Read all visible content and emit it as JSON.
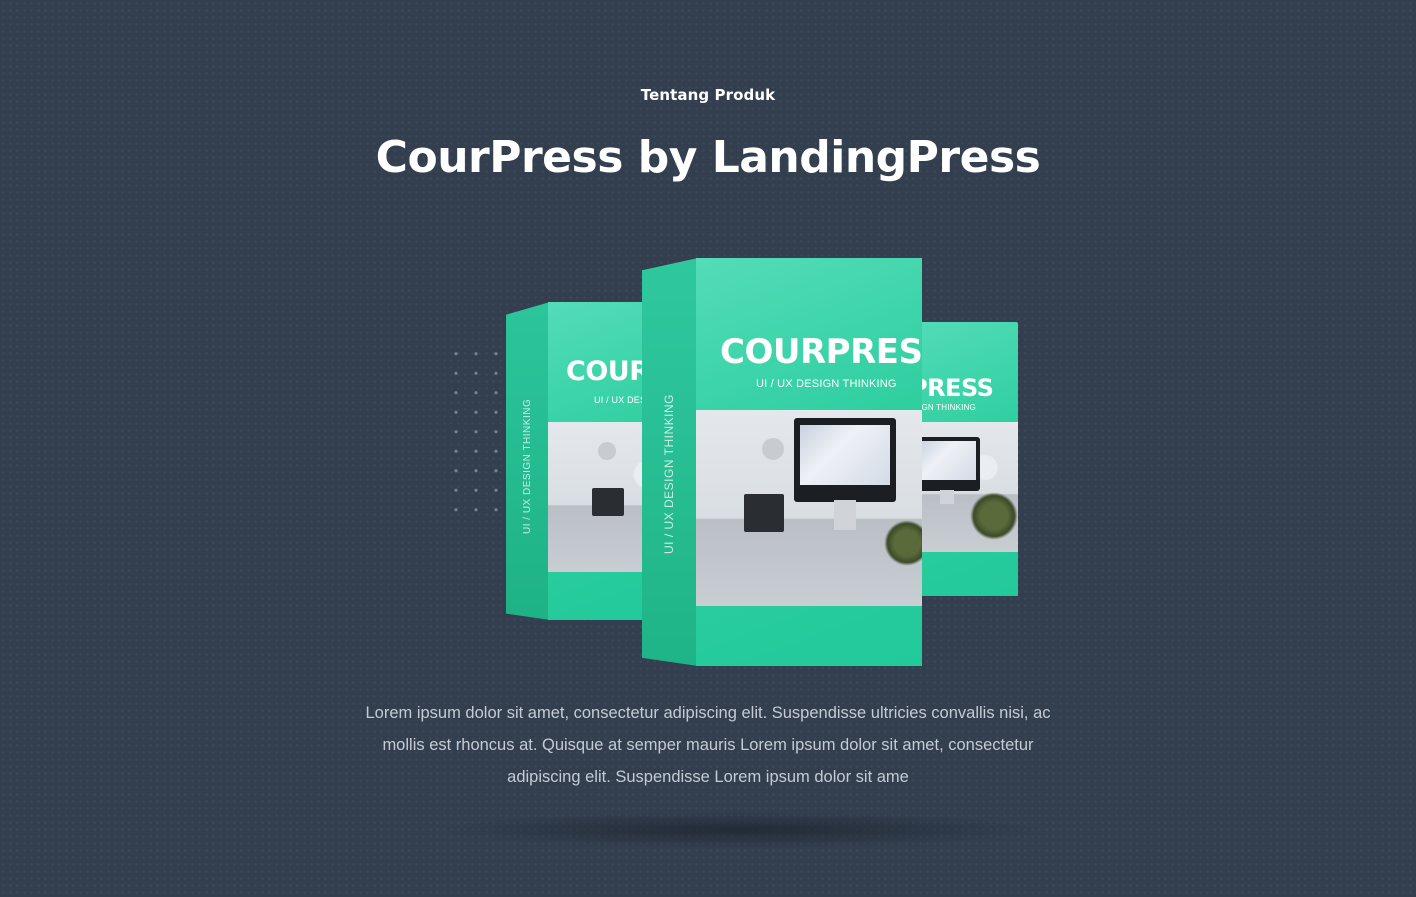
{
  "section": {
    "eyebrow": "Tentang Produk",
    "title": "CourPress by LandingPress",
    "description": "Lorem ipsum dolor sit amet, consectetur adipiscing elit. Suspendisse ultricies convallis nisi, ac mollis est rhoncus at. Quisque at semper mauris Lorem ipsum dolor sit amet, consectetur adipiscing elit. Suspendisse Lorem ipsum dolor sit ame"
  },
  "product_boxes": {
    "front": {
      "brand": "COURPRESS",
      "subtitle": "UI / UX DESIGN THINKING",
      "side_label": "UI / UX DESIGN THINKING"
    },
    "left": {
      "brand_visible": "COUR",
      "subtitle_visible": "UI / UX DESIG",
      "side_label": "UI / UX DESIGN THINKING"
    },
    "right": {
      "brand_visible": "RPRESS",
      "subtitle_visible": "DESIGN THINKING"
    }
  },
  "colors": {
    "background": "#333e4f",
    "accent": "#2fcfa0",
    "heading": "#ffffff",
    "body_text": "#c4cbd4"
  }
}
